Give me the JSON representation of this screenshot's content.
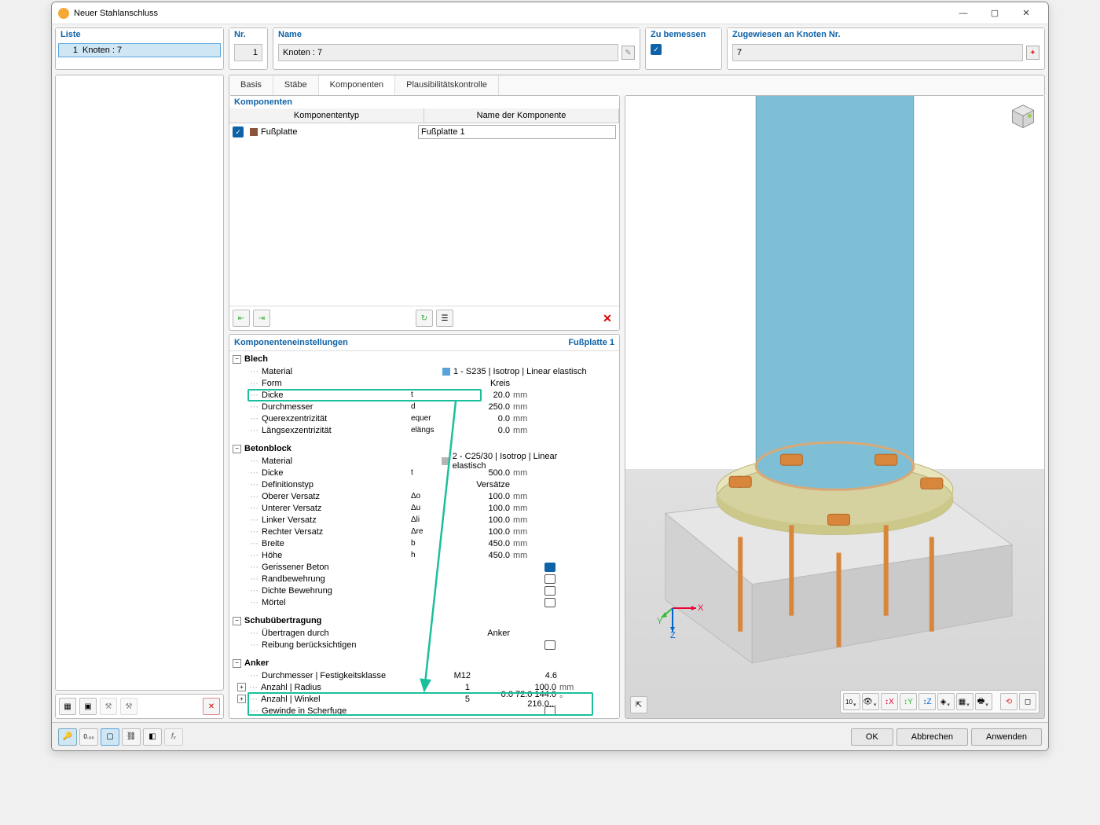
{
  "window": {
    "title": "Neuer Stahlanschluss"
  },
  "topPanels": {
    "liste": "Liste",
    "listRow": {
      "num": "1",
      "label": "Knoten : 7"
    },
    "nr": "Nr.",
    "nrVal": "1",
    "name": "Name",
    "nameVal": "Knoten : 7",
    "zube": "Zu bemessen",
    "zug": "Zugewiesen an Knoten Nr.",
    "zugVal": "7"
  },
  "tabs": [
    "Basis",
    "Stäbe",
    "Komponenten",
    "Plausibilitätskontrolle"
  ],
  "komp": {
    "title": "Komponenten",
    "col1": "Komponententyp",
    "col2": "Name der Komponente",
    "type": "Fußplatte",
    "name": "Fußplatte 1"
  },
  "settings": {
    "title": "Komponenteneinstellungen",
    "compName": "Fußplatte 1",
    "groups": {
      "blech": {
        "label": "Blech",
        "rows": [
          {
            "n": "Material",
            "sym": "",
            "val": "1 - S235 | Isotrop | Linear elastisch",
            "u": "",
            "mat": "#5aa3d9"
          },
          {
            "n": "Form",
            "sym": "",
            "val": "Kreis",
            "u": ""
          },
          {
            "n": "Dicke",
            "sym": "t",
            "val": "20.0",
            "u": "mm"
          },
          {
            "n": "Durchmesser",
            "sym": "d",
            "val": "250.0",
            "u": "mm"
          },
          {
            "n": "Querexzentrizität",
            "sym": "equer",
            "val": "0.0",
            "u": "mm"
          },
          {
            "n": "Längsexzentrizität",
            "sym": "elängs",
            "val": "0.0",
            "u": "mm"
          }
        ]
      },
      "beton": {
        "label": "Betonblock",
        "rows": [
          {
            "n": "Material",
            "sym": "",
            "val": "2 - C25/30 | Isotrop | Linear elastisch",
            "u": "",
            "mat": "#b5b5b5"
          },
          {
            "n": "Dicke",
            "sym": "t",
            "val": "500.0",
            "u": "mm"
          },
          {
            "n": "Definitionstyp",
            "sym": "",
            "val": "Versätze",
            "u": ""
          },
          {
            "n": "Oberer Versatz",
            "sym": "Δo",
            "val": "100.0",
            "u": "mm"
          },
          {
            "n": "Unterer Versatz",
            "sym": "Δu",
            "val": "100.0",
            "u": "mm"
          },
          {
            "n": "Linker Versatz",
            "sym": "Δli",
            "val": "100.0",
            "u": "mm"
          },
          {
            "n": "Rechter Versatz",
            "sym": "Δre",
            "val": "100.0",
            "u": "mm"
          },
          {
            "n": "Breite",
            "sym": "b",
            "val": "450.0",
            "u": "mm"
          },
          {
            "n": "Höhe",
            "sym": "h",
            "val": "450.0",
            "u": "mm"
          },
          {
            "n": "Gerissener Beton",
            "sym": "",
            "ck": true
          },
          {
            "n": "Randbewehrung",
            "sym": "",
            "ck": false
          },
          {
            "n": "Dichte Bewehrung",
            "sym": "",
            "ck": false
          },
          {
            "n": "Mörtel",
            "sym": "",
            "ck": false
          }
        ]
      },
      "schub": {
        "label": "Schubübertragung",
        "rows": [
          {
            "n": "Übertragen durch",
            "sym": "",
            "val": "Anker",
            "u": ""
          },
          {
            "n": "Reibung berücksichtigen",
            "sym": "",
            "ck": false
          }
        ]
      },
      "anker": {
        "label": "Anker",
        "rows": [
          {
            "n": "Durchmesser | Festigkeitsklasse",
            "sym": "",
            "v1": "M12",
            "v2": "4.6"
          },
          {
            "n": "Anzahl | Radius",
            "sym": "",
            "v1": "1",
            "v2": "100.0",
            "u": "mm",
            "exp": true
          },
          {
            "n": "Anzahl | Winkel",
            "sym": "",
            "v1": "5",
            "v2": "0.0 72.0 144.0 216.0...",
            "u": "°",
            "exp": true
          },
          {
            "n": "Gewinde in Scherfuge",
            "sym": "",
            "ck": false
          }
        ]
      }
    }
  },
  "buttons": {
    "ok": "OK",
    "cancel": "Abbrechen",
    "apply": "Anwenden"
  }
}
